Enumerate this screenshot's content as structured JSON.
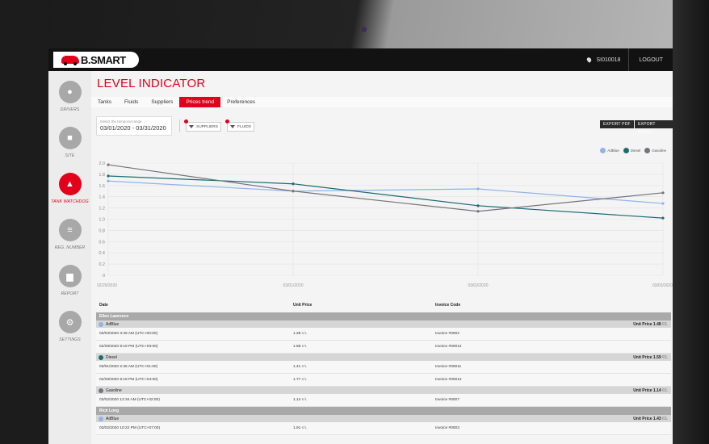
{
  "topbar": {
    "logo": "B.SMART",
    "station": "SI010018",
    "logout": "LOGOUT"
  },
  "sidebar": {
    "items": [
      {
        "label": "DRIVERS",
        "icon": "driver-icon",
        "active": false
      },
      {
        "label": "SITE",
        "icon": "fuel-pump-icon",
        "active": false
      },
      {
        "label": "TANK WATCHDOG",
        "icon": "tank-watchdog-icon",
        "active": true
      },
      {
        "label": "REG. NUMBER",
        "icon": "list-icon",
        "active": false
      },
      {
        "label": "REPORT",
        "icon": "bar-chart-icon",
        "active": false
      },
      {
        "label": "SETTINGS",
        "icon": "gear-icon",
        "active": false
      }
    ]
  },
  "page": {
    "title": "LEVEL INDICATOR",
    "tabs": [
      "Tanks",
      "Fluids",
      "Suppliers",
      "Prices trend",
      "Preferences"
    ],
    "active_tab": "Prices trend"
  },
  "filters": {
    "date_label": "Select the temporal range",
    "date_value": "03/01/2020 - 03/31/2020",
    "suppliers": "SUPPLIERS",
    "fluids": "FLUIDS",
    "export_pdf": "EXPORT PDF",
    "export_excel": "EXPORT EXCEL"
  },
  "chart_data": {
    "type": "line",
    "x": [
      "02/29/2020",
      "03/01/2020",
      "03/02/2020",
      "03/03/2020"
    ],
    "ylim": [
      0,
      2.0
    ],
    "yticks": [
      "0",
      "0.2",
      "0.4",
      "0.6",
      "0.8",
      "1.0",
      "1.2",
      "1.4",
      "1.6",
      "1.8",
      "2.0"
    ],
    "legend_position": "top-right",
    "grid": true,
    "series": [
      {
        "name": "AdBlue",
        "color": "#8fb4e8",
        "values": [
          1.68,
          1.5,
          1.54,
          1.28
        ]
      },
      {
        "name": "Diesel",
        "color": "#1b6b73",
        "values": [
          1.77,
          1.63,
          1.24,
          1.02
        ]
      },
      {
        "name": "Gasoline",
        "color": "#77727a",
        "values": [
          1.97,
          1.5,
          1.14,
          1.47
        ]
      }
    ]
  },
  "table": {
    "headers": {
      "date": "Date",
      "price": "Unit Price",
      "invoice": "Invoice Code"
    },
    "unit_label": "Unit Price",
    "unit": "€/L",
    "groups": [
      {
        "name": "Ellen Lawrence",
        "fluids": [
          {
            "name": "AdBlue",
            "color": "#8fb4e8",
            "avg": "1.48",
            "rows": [
              {
                "date": "03/03/2020 3:49 AM (UTC+00:00)",
                "price": "1.28",
                "invoice": "Invoice #0002"
              },
              {
                "date": "02/29/2020 9:19 PM (UTC+03:00)",
                "price": "1.68",
                "invoice": "Invoice #00012"
              }
            ]
          },
          {
            "name": "Diesel",
            "color": "#1b6b73",
            "avg": "1.59",
            "rows": [
              {
                "date": "03/01/2020 2:46 AM (UTC+01:00)",
                "price": "1.41",
                "invoice": "Invoice #00011"
              },
              {
                "date": "02/29/2020 9:19 PM (UTC+04:00)",
                "price": "1.77",
                "invoice": "Invoice #00012"
              }
            ]
          },
          {
            "name": "Gasoline",
            "color": "#77727a",
            "avg": "1.14",
            "rows": [
              {
                "date": "03/02/2020 12:34 AM (UTC+02:00)",
                "price": "1.14",
                "invoice": "Invoice #0007"
              }
            ]
          }
        ]
      },
      {
        "name": "Rick Long",
        "fluids": [
          {
            "name": "AdBlue",
            "color": "#8fb4e8",
            "avg": "1.43",
            "rows": [
              {
                "date": "03/02/2020 10:22 PM (UTC+07:00)",
                "price": "1.91",
                "invoice": "Invoice #0003"
              }
            ]
          }
        ]
      }
    ]
  }
}
